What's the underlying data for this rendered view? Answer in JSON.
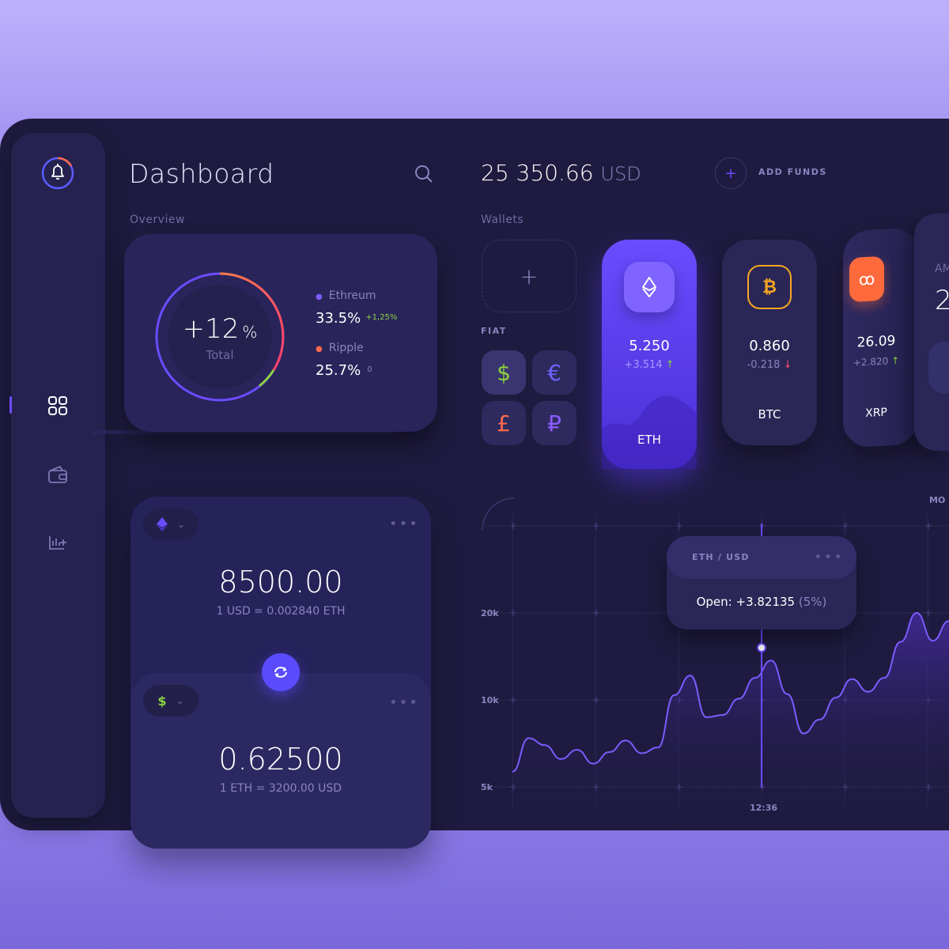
{
  "header": {
    "title": "Dashboard",
    "balance_value": "25 350.66",
    "balance_currency": "USD",
    "add_funds_label": "ADD FUNDS",
    "amount_partial_label": "AM",
    "amount_partial_value": "2"
  },
  "overview": {
    "label": "Overview",
    "total_value": "+12",
    "total_unit": "%",
    "total_label": "Total",
    "items": [
      {
        "name": "Ethreum",
        "value": "33.5%",
        "change": "+1,25%",
        "color": "#7d5cff"
      },
      {
        "name": "Ripple",
        "value": "25.7%",
        "change": "0",
        "color": "#ff6a4d"
      }
    ]
  },
  "converter": {
    "top_amount": "8500.00",
    "top_rate": "1 USD = 0.002840 ETH",
    "bottom_amount": "0.62500",
    "bottom_rate": "1 ETH = 3200.00 USD",
    "top_currency_icon": "ethereum-icon",
    "bottom_currency_icon": "dollar-icon",
    "bottom_currency_symbol": "$"
  },
  "wallets": {
    "label": "Wallets",
    "fiat_label": "FIAT",
    "fiat_symbols": [
      "$",
      "€",
      "£",
      "₽"
    ],
    "fiat_colors": [
      "#8bd13f",
      "#6f63ff",
      "#ff6a4d",
      "#8a5cff"
    ],
    "coins": [
      {
        "name": "ETH",
        "value": "5.250",
        "change": "+3.514",
        "direction": "up"
      },
      {
        "name": "BTC",
        "value": "0.860",
        "change": "-0.218",
        "direction": "down"
      },
      {
        "name": "XRP",
        "value": "26.09",
        "change": "+2.820",
        "direction": "up"
      }
    ]
  },
  "chart": {
    "partial_label": "MO",
    "y_ticks": [
      "20k",
      "10k",
      "5k"
    ],
    "x_label": "12:36",
    "tooltip": {
      "pair": "ETH / USD",
      "open_label": "Open:",
      "open_value": "+3.82135",
      "open_pct": "(5%)"
    }
  },
  "chart_data": {
    "type": "line",
    "series": [
      {
        "x": [
          0,
          1,
          2,
          3,
          4,
          5,
          6,
          7,
          8,
          9,
          10,
          11,
          12,
          13,
          14,
          15,
          16,
          17,
          18,
          19,
          20,
          21,
          22,
          23,
          24,
          25,
          26,
          27
        ],
        "values": [
          6.3,
          9.2,
          8.6,
          7.4,
          8.2,
          7.0,
          8.0,
          9.0,
          7.9,
          8.4,
          12.9,
          14.6,
          11.0,
          11.2,
          12.6,
          14.4,
          15.9,
          13.0,
          9.6,
          10.8,
          12.7,
          14.3,
          13.2,
          14.4,
          17.5,
          20.0,
          17.6,
          19.3
        ]
      }
    ],
    "y_ticks": [
      "20k",
      "10k",
      "5k"
    ],
    "highlight_label": "12:36"
  },
  "colors": {
    "accent": "#6c4cff",
    "up": "#8bd13f",
    "down": "#ff4d6d",
    "btc": "#f6a623",
    "xrp": "#ff6a3d"
  }
}
